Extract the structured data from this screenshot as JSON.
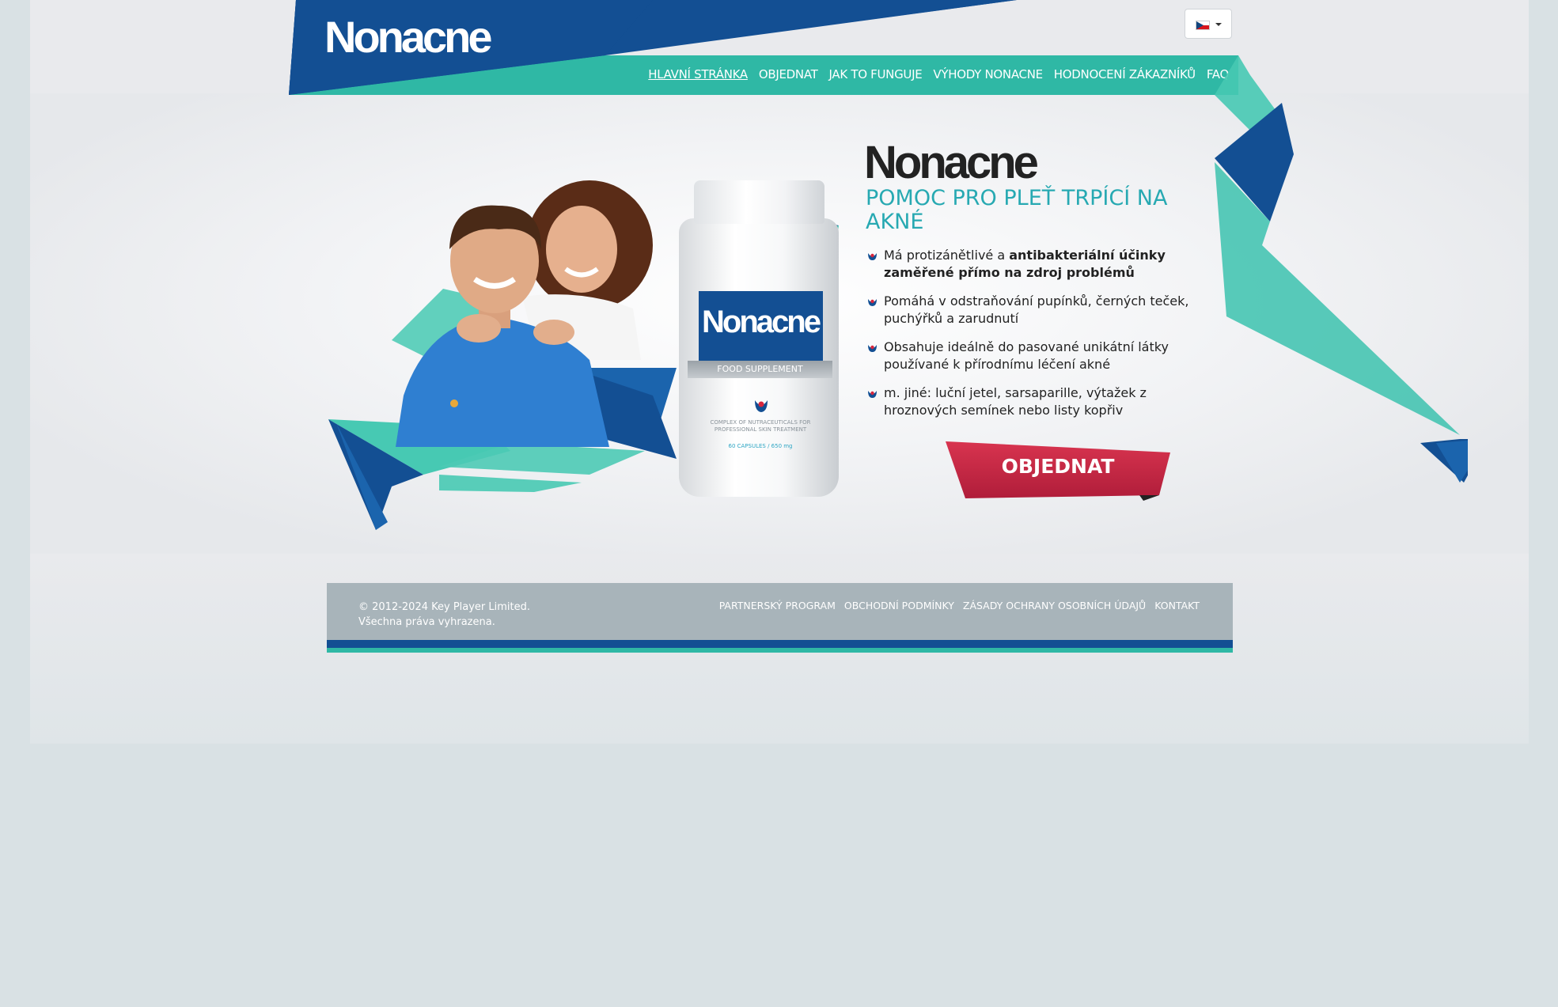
{
  "header": {
    "logo": "Nonacne",
    "language": {
      "flag": "cz-flag-icon"
    }
  },
  "nav": [
    {
      "label": "HLAVNÍ STRÁNKA",
      "active": true
    },
    {
      "label": "OBJEDNAT"
    },
    {
      "label": "JAK TO FUNGUJE"
    },
    {
      "label": "VÝHODY NONACNE"
    },
    {
      "label": "HODNOCENÍ ZÁKAZNÍKŮ"
    },
    {
      "label": "FAQ"
    }
  ],
  "product": {
    "brand": "Nonacne",
    "headline": "POMOC PRO PLEŤ TRPÍCÍ NA AKNÉ",
    "bullets": [
      {
        "plain": "Má protizánětlivé a ",
        "bold": "antibakteriální účinky zaměřené přímo na zdroj problémů"
      },
      {
        "plain": "Pomáhá v odstraňování pupínků, černých teček, puchýřků a zarudnutí",
        "bold": ""
      },
      {
        "plain": "Obsahuje ideálně do pasované unikátní látky používané k přírodnímu léčení akné",
        "bold": ""
      },
      {
        "plain": "m. jiné: luční jetel, sarsaparille, výtažek z hroznových semínek nebo listy kopřiv",
        "bold": ""
      }
    ],
    "order_label": "OBJEDNAT"
  },
  "bottle": {
    "logo": "Nonacne",
    "band": "FOOD SUPPLEMENT",
    "small_text": "COMPLEX OF NUTRACEUTICALS FOR PROFESSIONAL SKIN TREATMENT",
    "capsules": "60 CAPSULES / 650 mg"
  },
  "footer": {
    "copyright_line1": "© 2012-2024 Key Player Limited.",
    "copyright_line2": "Všechna práva vyhrazena.",
    "links": [
      "PARTNERSKÝ PROGRAM",
      "OBCHODNÍ PODMÍNKY",
      "ZÁSADY OCHRANY OSOBNÍCH ÚDAJŮ",
      "KONTAKT"
    ]
  },
  "colors": {
    "brand_blue": "#134f93",
    "teal": "#2fb8a5",
    "headline_teal": "#27a9b2",
    "order_red": "#c0233f",
    "footer_gray": "#a8b4ba"
  }
}
